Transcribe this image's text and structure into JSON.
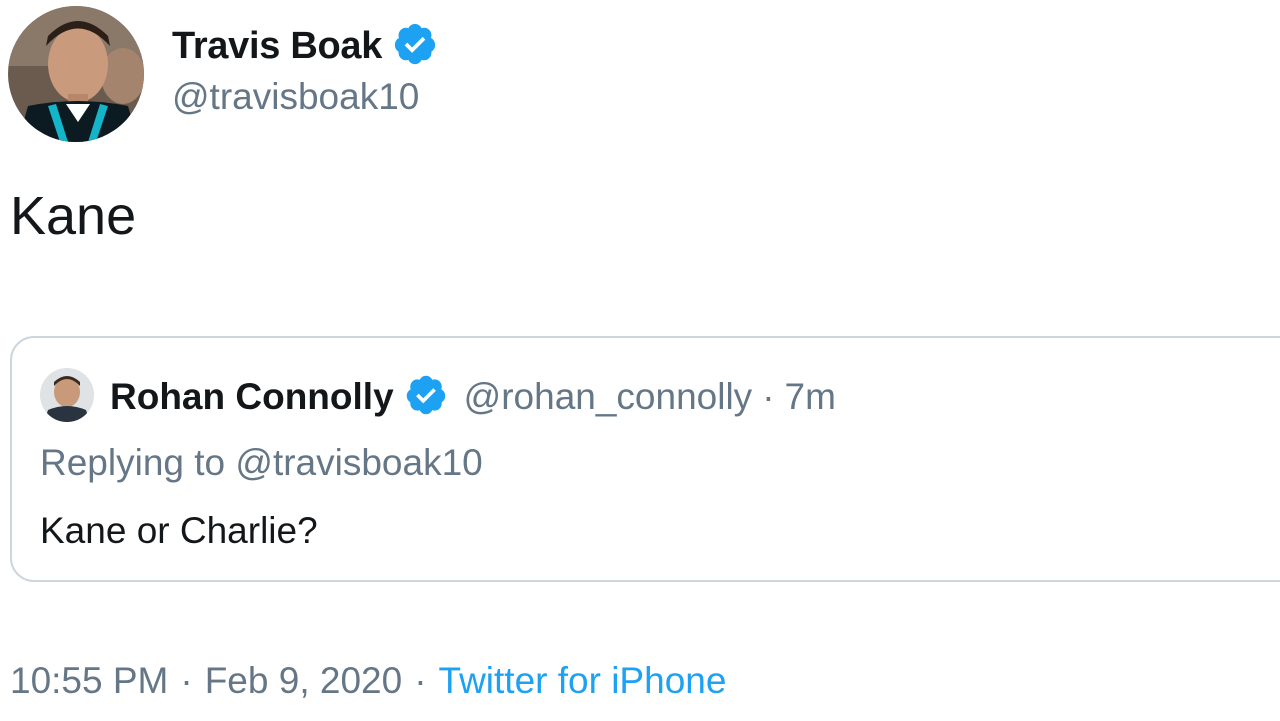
{
  "author": {
    "name": "Travis Boak",
    "handle": "@travisboak10",
    "verified_icon": "verified-badge-icon",
    "avatar": "profile-photo"
  },
  "tweet": {
    "text": "Kane"
  },
  "quoted_tweet": {
    "name": "Rohan Connolly",
    "handle": "@rohan_connolly",
    "separator": "·",
    "time": "7m",
    "replying_to": "Replying to @travisboak10",
    "text": "Kane or Charlie?",
    "verified_icon": "verified-badge-icon",
    "avatar": "profile-photo"
  },
  "meta": {
    "time": "10:55 PM",
    "separator": "·",
    "date": "Feb 9, 2020",
    "source": "Twitter for iPhone"
  },
  "colors": {
    "verified": "#1da1f2",
    "link": "#1da1f2",
    "secondary_text": "#657786",
    "border": "#ccd6dd"
  }
}
